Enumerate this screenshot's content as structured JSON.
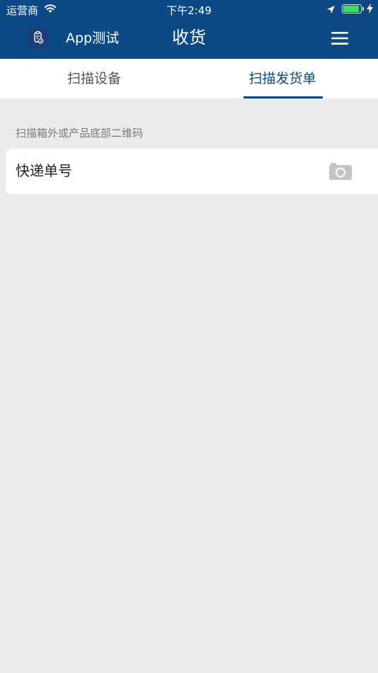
{
  "status_bar": {
    "carrier": "运营商",
    "time": "下午2:49",
    "battery_level": 1.0
  },
  "header": {
    "app_name": "App测试",
    "title": "收货",
    "icons": [
      "app-logo-icon",
      "hamburger-menu-icon"
    ]
  },
  "tabs": [
    {
      "label": "扫描设备",
      "selected": false
    },
    {
      "label": "扫描发货单",
      "selected": true
    }
  ],
  "form": {
    "hint": "扫描箱外或产品底部二维码",
    "field_label": "快递单号",
    "field_icon": "camera-icon"
  },
  "colors": {
    "primary": "#0d4a85",
    "background": "#ebebeb",
    "battery": "#3ddc67"
  }
}
